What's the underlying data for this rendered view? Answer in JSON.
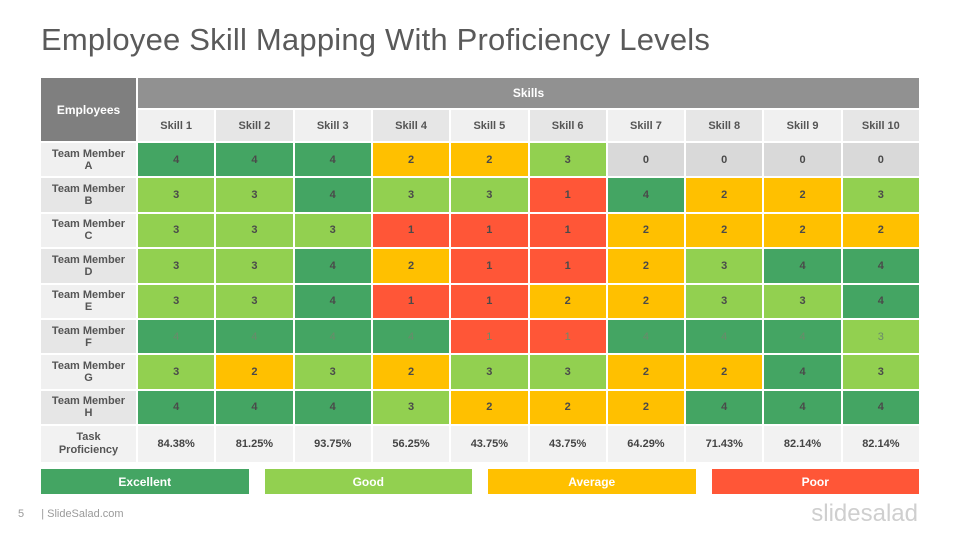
{
  "title": "Employee Skill Mapping With Proficiency Levels",
  "table": {
    "employees_header": "Employees",
    "skills_header": "Skills",
    "skills": [
      "Skill 1",
      "Skill 2",
      "Skill 3",
      "Skill 4",
      "Skill 5",
      "Skill 6",
      "Skill 7",
      "Skill 8",
      "Skill 9",
      "Skill 10"
    ],
    "rows": [
      {
        "name_line1": "Team Member",
        "name_line2": "A",
        "values": [
          4,
          4,
          4,
          2,
          2,
          3,
          0,
          0,
          0,
          0
        ]
      },
      {
        "name_line1": "Team Member",
        "name_line2": "B",
        "values": [
          3,
          3,
          4,
          3,
          3,
          1,
          4,
          2,
          2,
          3
        ]
      },
      {
        "name_line1": "Team Member",
        "name_line2": "C",
        "values": [
          3,
          3,
          3,
          1,
          1,
          1,
          2,
          2,
          2,
          2
        ]
      },
      {
        "name_line1": "Team Member",
        "name_line2": "D",
        "values": [
          3,
          3,
          4,
          2,
          1,
          1,
          2,
          3,
          4,
          4
        ]
      },
      {
        "name_line1": "Team Member",
        "name_line2": "E",
        "values": [
          3,
          3,
          4,
          1,
          1,
          2,
          2,
          3,
          3,
          4
        ]
      },
      {
        "name_line1": "Team Member",
        "name_line2": "F",
        "values": [
          4,
          4,
          4,
          4,
          1,
          1,
          4,
          4,
          4,
          3
        ]
      },
      {
        "name_line1": "Team Member",
        "name_line2": "G",
        "values": [
          3,
          2,
          3,
          2,
          3,
          3,
          2,
          2,
          4,
          3
        ]
      },
      {
        "name_line1": "Team Member",
        "name_line2": "H",
        "values": [
          4,
          4,
          4,
          3,
          2,
          2,
          2,
          4,
          4,
          4
        ]
      }
    ],
    "proficiency_label_line1": "Task",
    "proficiency_label_line2": "Proficiency",
    "proficiency": [
      "84.38%",
      "81.25%",
      "93.75%",
      "56.25%",
      "43.75%",
      "43.75%",
      "64.29%",
      "71.43%",
      "82.14%",
      "82.14%"
    ]
  },
  "legend": [
    {
      "label": "Excellent",
      "color": "#44a563"
    },
    {
      "label": "Good",
      "color": "#92d050"
    },
    {
      "label": "Average",
      "color": "#ffc000"
    },
    {
      "label": "Poor",
      "color": "#ff5637"
    }
  ],
  "footer": {
    "page_number": "5",
    "site": "| SlideSalad.com",
    "brand": "slidesalad"
  }
}
